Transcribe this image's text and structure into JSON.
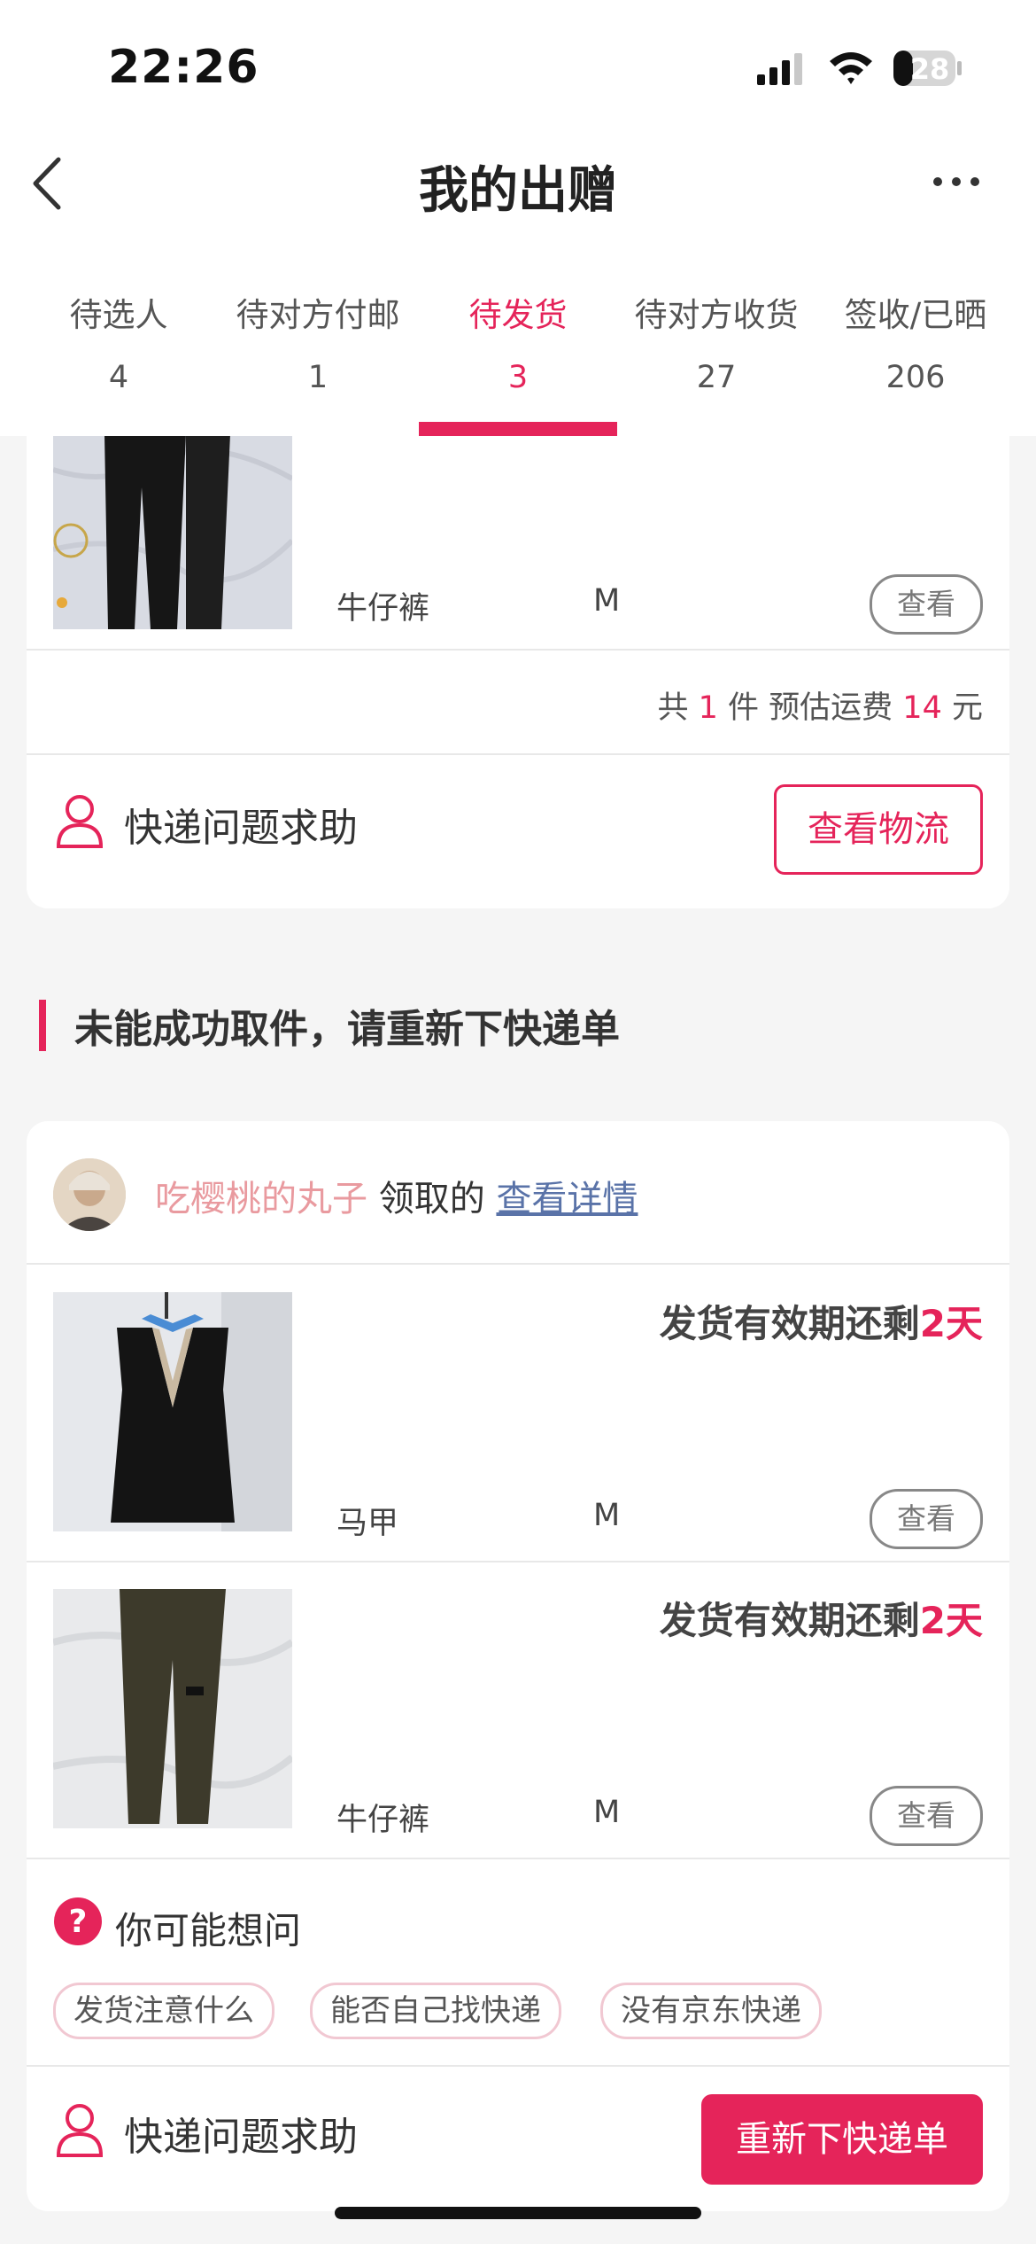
{
  "status_bar": {
    "time": "22:26",
    "battery": "28"
  },
  "nav": {
    "title": "我的出赠"
  },
  "tabs": [
    {
      "label": "待选人",
      "count": "4"
    },
    {
      "label": "待对方付邮",
      "count": "1"
    },
    {
      "label": "待发货",
      "count": "3",
      "active": true
    },
    {
      "label": "待对方收货",
      "count": "27"
    },
    {
      "label": "签收/已晒",
      "count": "206"
    }
  ],
  "card1": {
    "item": {
      "name": "牛仔裤",
      "size": "M",
      "view_label": "查看"
    },
    "summary": {
      "prefix": "共",
      "count": "1",
      "unit": "件 预估运费",
      "fee": "14",
      "currency": "元"
    },
    "help_label": "快递问题求助",
    "logistics_button": "查看物流"
  },
  "section": {
    "title": "未能成功取件，请重新下快递单"
  },
  "card2": {
    "user": {
      "name": "吃樱桃的丸子",
      "action": "领取的",
      "details_link": "查看详情"
    },
    "items": [
      {
        "name": "马甲",
        "size": "M",
        "view_label": "查看",
        "deadline_prefix": "发货有效期还剩",
        "deadline_value": "2天"
      },
      {
        "name": "牛仔裤",
        "size": "M",
        "view_label": "查看",
        "deadline_prefix": "发货有效期还剩",
        "deadline_value": "2天"
      }
    ],
    "faq": {
      "title": "你可能想问",
      "chips": [
        "发货注意什么",
        "能否自己找快递",
        "没有京东快递"
      ]
    },
    "help_label": "快递问题求助",
    "reorder_button": "重新下快递单"
  },
  "colors": {
    "accent": "#e5245a",
    "link": "#5a73a8",
    "username": "#e99a9f"
  },
  "icons": [
    "back-icon",
    "more-icon",
    "signal-icon",
    "wifi-icon",
    "battery-icon",
    "user-icon",
    "question-icon"
  ]
}
